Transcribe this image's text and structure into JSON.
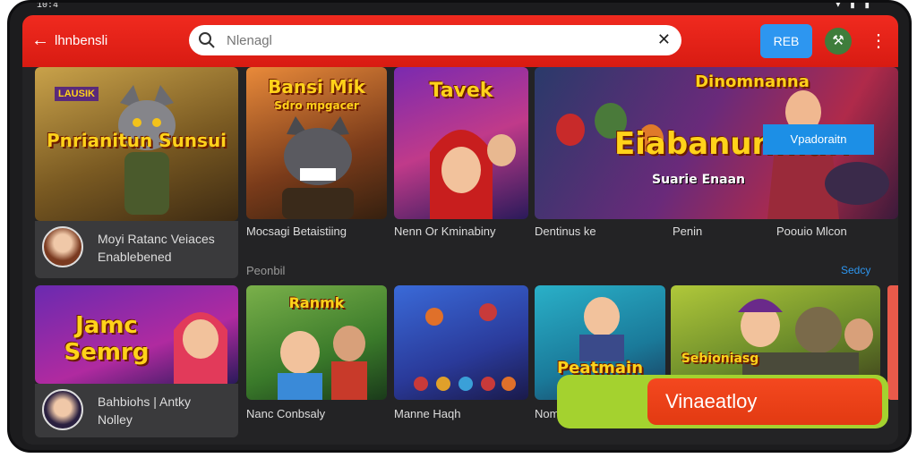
{
  "status": {
    "time": "10:4 ",
    "icons": "▾ ▮ ▮"
  },
  "topbar": {
    "title": "lhnbensli",
    "action_button": "REB",
    "avatar_icon": "wrench-icon"
  },
  "search": {
    "placeholder": "Nlenagl"
  },
  "row1": [
    {
      "art": "Pnrianitun Sunsui",
      "badge": "LAUSIK",
      "info_line1": "Moyi Ratanc Veiaces",
      "info_line2": "Enablebened"
    },
    {
      "art": "Bansi Mik",
      "subart": "Sdro mpgacer",
      "caption": "Mocsagi Betaistiing"
    },
    {
      "art": "Tavek",
      "caption": "Nenn Or Kminabiny"
    },
    {
      "art": "Dinomnanna",
      "headline": "Eiabanunnial?",
      "sub": "Suarie Enaan",
      "chip": "Vpadoraitn",
      "caption_a": "Dentinus ke",
      "caption_b": "Penin",
      "caption_c": "Poouio Mlcon"
    }
  ],
  "section_label": "Peonbil",
  "section_link": "Sedcy",
  "row2": [
    {
      "art": "Jamc Semrg",
      "info_line1": "Bahbiohs | Antky",
      "info_line2": "Nolley"
    },
    {
      "art": "Ranmk",
      "caption": "Nanc Conbsaly"
    },
    {
      "art": "",
      "caption": "Manne Haqh"
    },
    {
      "art": "Peatmain",
      "caption": "Nome"
    },
    {
      "art": "Sebioniasg",
      "caption": ""
    }
  ],
  "cta": {
    "label": "Vinaeatloy"
  },
  "colors": {
    "accent": "#f02a1f",
    "blue": "#2d96f0",
    "cta_green": "#a4d22f",
    "cta_red": "#f4481f"
  }
}
